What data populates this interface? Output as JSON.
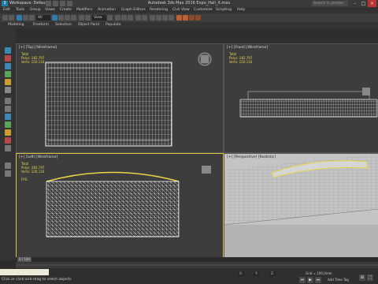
{
  "app": {
    "title": "Autodesk 3ds Max 2016   Expo_Hall_X.max",
    "logo": "3",
    "workspace": "Workspace: Default",
    "search_placeholder": "Search in photos",
    "help_icon": "question-icon"
  },
  "menus": [
    "Edit",
    "Tools",
    "Group",
    "Views",
    "Create",
    "Modifiers",
    "Animation",
    "Graph Editors",
    "Rendering",
    "Civil View",
    "Customize",
    "Scripting",
    "Help"
  ],
  "toolbar": {
    "selection_filter": "All",
    "view": "View"
  },
  "ribbon": {
    "items": [
      "Modeling",
      "Freeform",
      "Selection",
      "Object Paint",
      "Populate"
    ]
  },
  "viewports": {
    "top": {
      "label": "[+] [Top] [Wireframe]",
      "stats": [
        "Total",
        "Polys: 282,797",
        "Verts: 220,116"
      ]
    },
    "front": {
      "label": "[+] [Front] [Wireframe]",
      "stats": [
        "Total",
        "Polys: 282,797",
        "Verts: 220,116"
      ]
    },
    "left": {
      "label": "[+] [Left] [Wireframe]",
      "stats": [
        "Total",
        "Polys: 282,797",
        "Verts: 220,116"
      ],
      "fps": "FPS:"
    },
    "perspective": {
      "label": "[+] [Perspective] [Realistic]"
    }
  },
  "timeline": {
    "frame": "0 / 100"
  },
  "status": {
    "prompt": "Click or click-and-drag to select objects",
    "grid": "Grid = 100,0mm",
    "add_time_tag": "Add Time Tag",
    "x": "X:",
    "y": "Y:",
    "z": "Z:"
  },
  "colors": {
    "selected_border": "#e0c040",
    "stats_text": "#e8d44a"
  }
}
